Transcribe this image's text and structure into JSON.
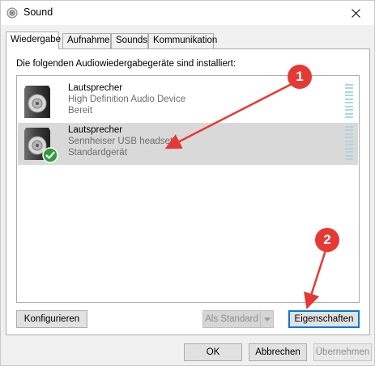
{
  "window": {
    "title": "Sound",
    "close_glyph": "✕"
  },
  "tabs": [
    {
      "label": "Wiedergabe",
      "active": true
    },
    {
      "label": "Aufnahme",
      "active": false
    },
    {
      "label": "Sounds",
      "active": false
    },
    {
      "label": "Kommunikation",
      "active": false
    }
  ],
  "panel": {
    "instruction": "Die folgenden Audiowiedergabegeräte sind installiert:",
    "devices": [
      {
        "name": "Lautsprecher",
        "description": "High Definition Audio Device",
        "status": "Bereit",
        "selected": false,
        "default": false
      },
      {
        "name": "Lautsprecher",
        "description": "Sennheiser USB headset",
        "status": "Standardgerät",
        "selected": true,
        "default": true
      }
    ],
    "buttons": {
      "configure": "Konfigurieren",
      "set_default": "Als Standard",
      "properties": "Eigenschaften"
    }
  },
  "footer": {
    "ok": "OK",
    "cancel": "Abbrechen",
    "apply": "Übernehmen"
  },
  "annotations": {
    "badge1": "1",
    "badge2": "2",
    "color": "#e53935"
  }
}
